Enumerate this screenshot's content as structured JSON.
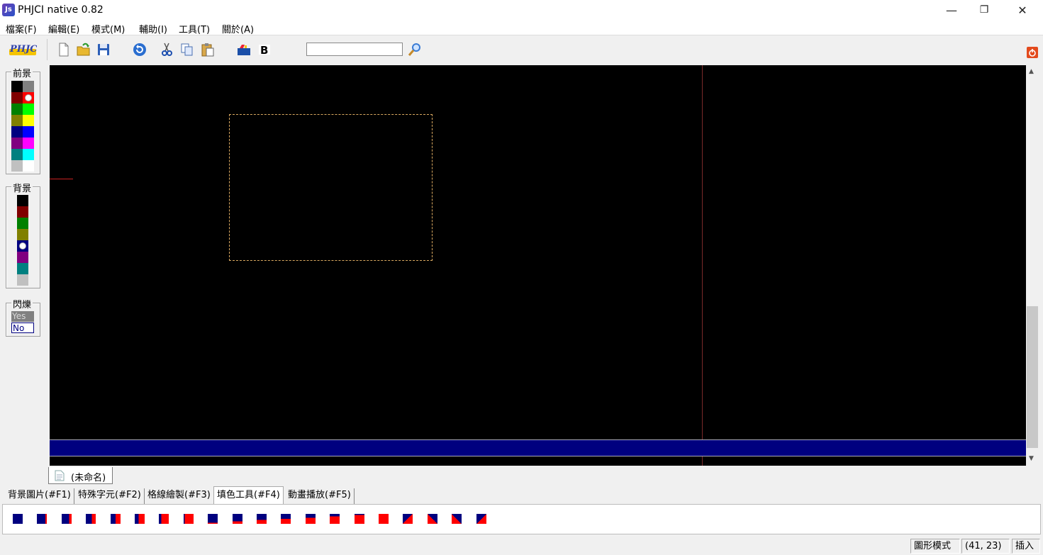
{
  "window": {
    "icon_text": "Js",
    "title": "PHJCI native 0.82",
    "minimize": "—",
    "maximize": "❐",
    "close": "✕"
  },
  "menu": [
    {
      "label": "檔案(F)"
    },
    {
      "label": "編輯(E)"
    },
    {
      "label": "模式(M)"
    },
    {
      "label": "輔助(I)"
    },
    {
      "label": "工具(T)"
    },
    {
      "label": "關於(A)"
    }
  ],
  "toolbar": {
    "logo_text": "PHJCI",
    "search_value": "",
    "bold_label": "B"
  },
  "palette": {
    "foreground_label": "前景",
    "background_label": "背景",
    "blink_label": "閃爍",
    "blink_yes": "Yes",
    "blink_no": "No",
    "blink_selected": "No",
    "foreground_colors": [
      "#000000",
      "#808080",
      "#800000",
      "#ff0000",
      "#008000",
      "#00ff00",
      "#808000",
      "#ffff00",
      "#000080",
      "#0000ff",
      "#800080",
      "#ff00ff",
      "#008080",
      "#00ffff",
      "#c0c0c0",
      "#ffffff"
    ],
    "foreground_selected": "#ff0000",
    "background_colors": [
      "#000000",
      "#800000",
      "#008000",
      "#808000",
      "#000080",
      "#800080",
      "#008080",
      "#c0c0c0"
    ],
    "background_selected": "#000080"
  },
  "canvas": {
    "background": "#000000",
    "band_color": "#00007f",
    "cursor_color": "#ff3333"
  },
  "document_tab": {
    "label": "(未命名)"
  },
  "tool_tabs": [
    {
      "label": "背景圖片(#F1)"
    },
    {
      "label": "特殊字元(#F2)"
    },
    {
      "label": "格線繪製(#F3)"
    },
    {
      "label": "填色工具(#F4)",
      "active": true
    },
    {
      "label": "動畫播放(#F5)"
    }
  ],
  "fill_patterns": [
    "full-blue",
    "right-eighth",
    "right-quarter",
    "right-third",
    "right-half",
    "right-half-b",
    "right-majority",
    "full-red-left-blue",
    "top-eighth",
    "bottom-quarter",
    "bottom-third",
    "bottom-half",
    "bottom-half-b",
    "bottom-majority",
    "full-red",
    "full-red-b",
    "diag-br",
    "diag-tr",
    "diag-bl",
    "diag-tl"
  ],
  "status": {
    "mode": "圖形模式",
    "coords": "(41, 23)",
    "insert": "插入"
  }
}
